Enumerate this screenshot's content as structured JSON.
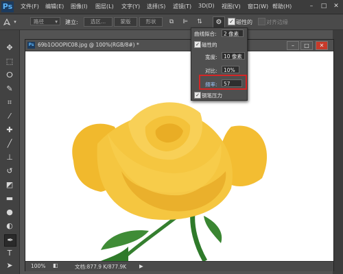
{
  "app": {
    "logo": "Ps"
  },
  "menu": [
    "文件(F)",
    "编辑(E)",
    "图像(I)",
    "图层(L)",
    "文字(Y)",
    "选择(S)",
    "滤镜(T)",
    "3D(D)",
    "视图(V)",
    "窗口(W)",
    "帮助(H)"
  ],
  "window_controls": {
    "minimize": "–",
    "maximize": "□",
    "close": "✕"
  },
  "options": {
    "tool_mode": "路径",
    "build_label": "建立:",
    "selection_btn": "选区...",
    "mask_btn": "蒙版",
    "shape_btn": "形状",
    "magnetic_label": "磁性的",
    "align_edges_label": "对齐边缘"
  },
  "document": {
    "title": "69b1OOOPIC08.jpg @ 100%(RGB/8#) *",
    "zoom": "100%",
    "doc_info": "文档:877.9 K/877.9K"
  },
  "popup": {
    "curve_fit_label": "曲线拟合:",
    "curve_fit_value": "2 像素",
    "magnetic_label": "磁性的",
    "width_label": "宽度:",
    "width_value": "10 像素",
    "contrast_label": "对比:",
    "contrast_value": "10%",
    "frequency_label": "频率:",
    "frequency_value": "57",
    "pen_pressure_label": "钢笔压力",
    "magnetic_checked": true,
    "pen_pressure_checked": true
  },
  "tools": [
    "move-tool",
    "marquee-tool",
    "lasso-tool",
    "quick-select-tool",
    "crop-tool",
    "eyedropper-tool",
    "healing-tool",
    "brush-tool",
    "clone-stamp-tool",
    "history-brush-tool",
    "eraser-tool",
    "gradient-tool",
    "blur-tool",
    "dodge-tool",
    "pen-tool",
    "type-tool",
    "path-select-tool",
    "rectangle-tool",
    "hand-tool"
  ],
  "colors": {
    "accent_highlight": "#d42626",
    "rose_yellow": "#f7c843",
    "stem_green": "#2f7a2a"
  }
}
